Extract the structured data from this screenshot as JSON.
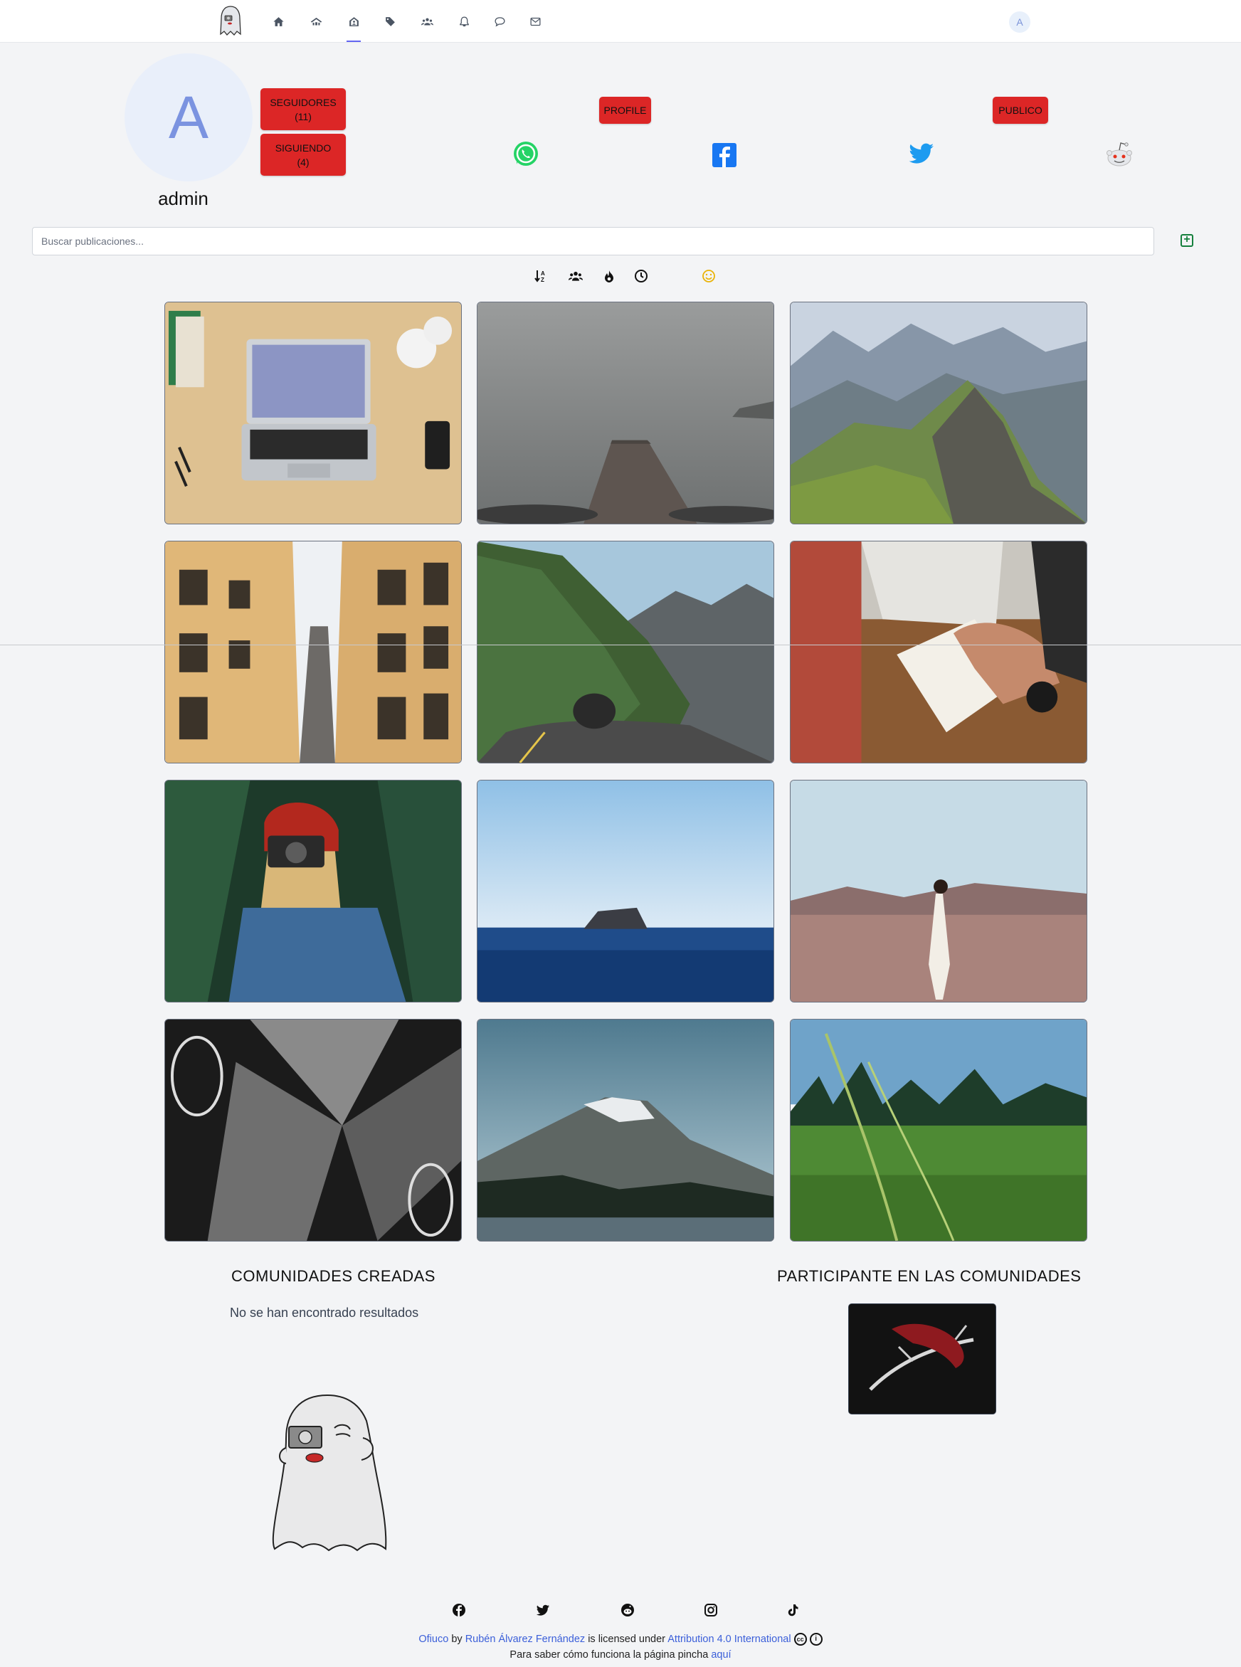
{
  "nav": {
    "items": [
      "home-icon",
      "community-icon",
      "profile-icon",
      "tags-icon",
      "users-icon",
      "notifications-icon",
      "chat-icon",
      "mail-icon"
    ],
    "avatar_initial": "A"
  },
  "profile": {
    "avatar_initial": "A",
    "username": "admin",
    "followers_label": "SEGUIDORES",
    "followers_count": "(11)",
    "following_label": "SIGUIENDO",
    "following_count": "(4)",
    "profile_label": "PROFILE",
    "visibility_label": "PUBLICO",
    "share_icons": [
      "whatsapp-icon",
      "facebook-icon",
      "twitter-icon",
      "reddit-icon"
    ]
  },
  "search": {
    "placeholder": "Buscar publicaciones...",
    "value": ""
  },
  "sort_icons": [
    "sort-alpha-icon",
    "followers-sort-icon",
    "trending-fire-icon",
    "recent-clock-icon",
    "mood-smile-icon"
  ],
  "posts": [
    {
      "subject": "laptop on desk"
    },
    {
      "subject": "foggy pier"
    },
    {
      "subject": "mountain ridge"
    },
    {
      "subject": "city street balconies"
    },
    {
      "subject": "mountain road tunnel"
    },
    {
      "subject": "hand writing notebook"
    },
    {
      "subject": "woman with camera"
    },
    {
      "subject": "ocean island"
    },
    {
      "subject": "woman in desert"
    },
    {
      "subject": "architecture arch"
    },
    {
      "subject": "snowy mountain lake"
    },
    {
      "subject": "grass field"
    }
  ],
  "communities": {
    "created_title": "COMUNIDADES CREADAS",
    "created_empty": "No se han encontrado resultados",
    "participant_title": "PARTICIPANTE EN LAS COMUNIDADES"
  },
  "footer": {
    "social_icons": [
      "facebook-icon",
      "twitter-icon",
      "reddit-icon",
      "instagram-icon",
      "tiktok-icon"
    ],
    "site_name": "Ofiuco",
    "by_text": "by",
    "author": "Rubén Álvarez Fernández",
    "licensed_text": "is licensed under",
    "license": "Attribution 4.0 International",
    "help_text": "Para saber cómo funciona la página pincha",
    "help_link": "aquí"
  },
  "colors": {
    "accent_red": "#dc2626",
    "avatar_bg": "#e9effa",
    "link_blue": "#3b5fd9",
    "add_green": "#15803d"
  }
}
